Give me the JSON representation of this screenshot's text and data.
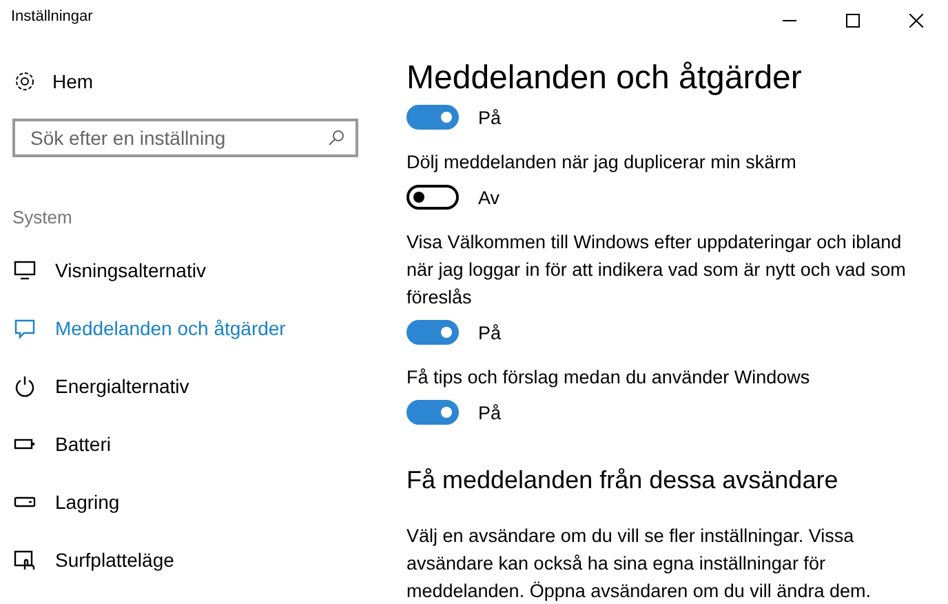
{
  "window": {
    "title": "Inställningar"
  },
  "sidebar": {
    "home": "Hem",
    "search": {
      "placeholder": "Sök efter en inställning"
    },
    "section": "System",
    "items": [
      {
        "label": "Visningsalternativ",
        "selected": false
      },
      {
        "label": "Meddelanden och åtgärder",
        "selected": true
      },
      {
        "label": "Energialternativ",
        "selected": false
      },
      {
        "label": "Batteri",
        "selected": false
      },
      {
        "label": "Lagring",
        "selected": false
      },
      {
        "label": "Surfplatteläge",
        "selected": false
      }
    ]
  },
  "main": {
    "title": "Meddelanden och åtgärder",
    "settings": [
      {
        "on": true,
        "state": "På"
      },
      {
        "label": "Dölj meddelanden när jag duplicerar min skärm",
        "on": false,
        "state": "Av"
      },
      {
        "label": "Visa Välkommen till Windows efter uppdateringar och ibland när jag loggar in för att indikera vad som är nytt och vad som föreslås",
        "on": true,
        "state": "På"
      },
      {
        "label": "Få tips och förslag medan du använder Windows",
        "on": true,
        "state": "På"
      }
    ],
    "section_title": "Få meddelanden från dessa avsändare",
    "section_text": "Välj en avsändare om du vill se fler inställningar. Vissa avsändare kan också ha sina egna inställningar för meddelanden. Öppna avsändaren om du vill ändra dem."
  }
}
